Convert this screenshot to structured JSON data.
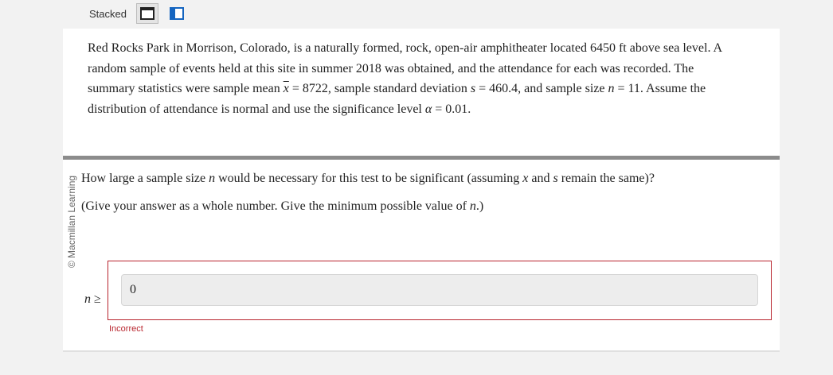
{
  "toolbar": {
    "layout_label": "Stacked",
    "stacked_icon": "stacked-layout-icon",
    "side_icon": "side-by-side-layout-icon"
  },
  "stem": {
    "line1": "Red Rocks Park in Morrison, Colorado, is a naturally formed, rock, open-air amphitheater located 6450 ft above sea level. A",
    "line2": "random sample of events held at this site in summer 2018 was obtained, and the attendance for each was recorded. The",
    "line3_a": "summary statistics were sample mean ",
    "line3_mean_symbol": "x",
    "line3_b": " = 8722, sample standard deviation ",
    "line3_s_symbol": "s",
    "line3_c": " = 460.4, and sample size ",
    "line3_n_symbol": "n",
    "line3_d": " = 11. Assume the",
    "line4_a": "distribution of attendance is normal and use the significance level ",
    "line4_alpha_symbol": "α",
    "line4_b": " = 0.01."
  },
  "copyright": "© Macmillan Learning",
  "question": {
    "a": "How large a sample size ",
    "n": "n",
    "b": " would be necessary for this test to be significant (assuming ",
    "x": "x",
    "c": " and ",
    "s": "s",
    "d": " remain the same)?"
  },
  "note": {
    "a": "(Give your answer as a whole number. Give the minimum possible value of ",
    "n": "n",
    "b": ".)"
  },
  "answer": {
    "label_var": "n",
    "label_symbol": " ≥",
    "value": "0",
    "status": "Incorrect"
  },
  "colors": {
    "error": "#b8242d",
    "divider": "#8c8c8c",
    "icon": "#1565c0"
  }
}
